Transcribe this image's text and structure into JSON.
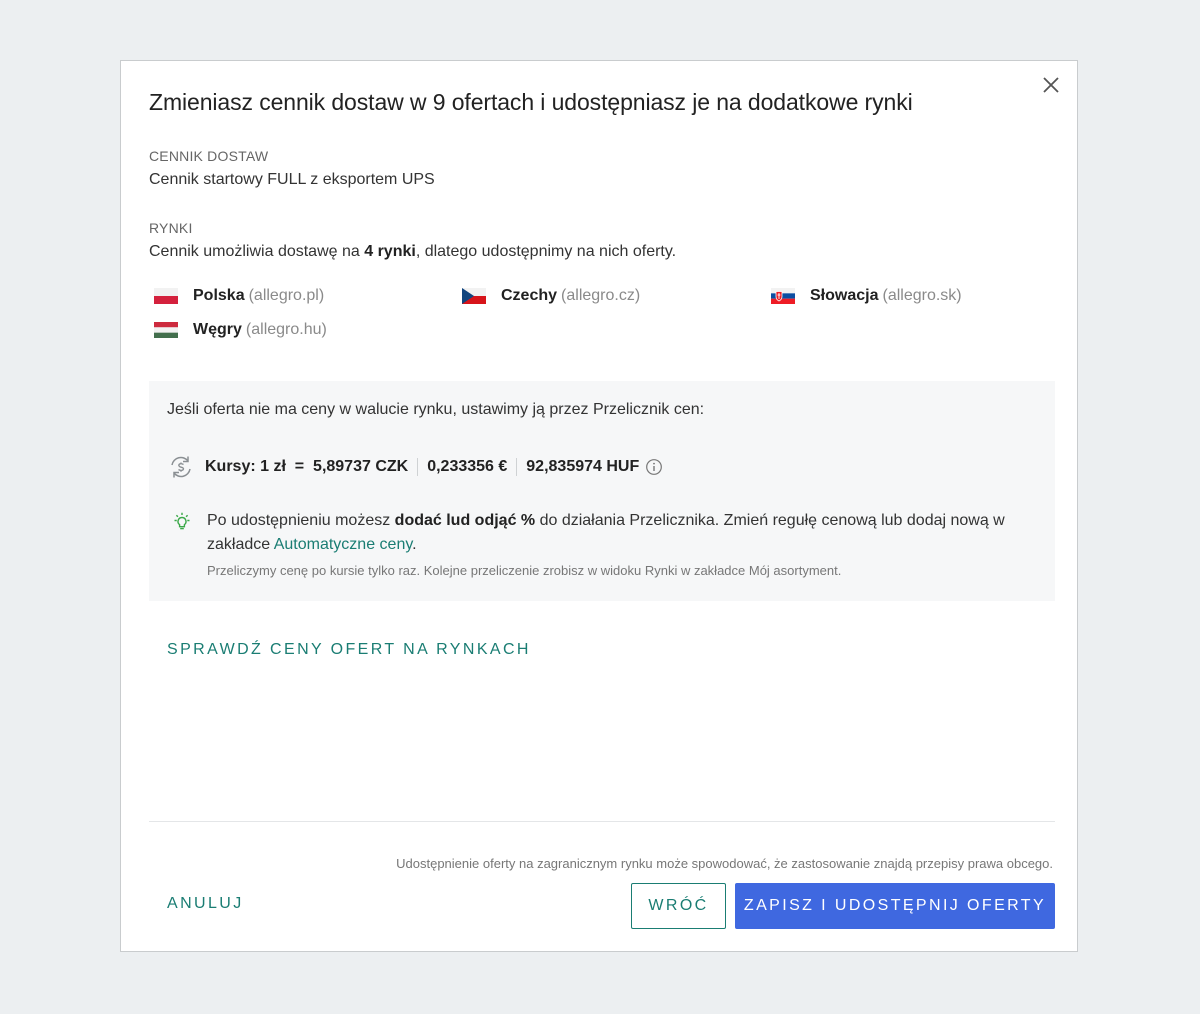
{
  "modal": {
    "title": "Zmieniasz cennik dostaw w 9 ofertach i udostępniasz je na dodatkowe rynki",
    "close_icon": "close-icon"
  },
  "shipping_price_list": {
    "label": "CENNIK DOSTAW",
    "value": "Cennik startowy FULL z eksportem UPS"
  },
  "markets": {
    "label": "RYNKI",
    "description_prefix": "Cennik umożliwia dostawę na ",
    "description_bold": "4 rynki",
    "description_suffix": ", dlatego udostępnimy na nich oferty.",
    "items": [
      {
        "name": "Polska",
        "domain": "(allegro.pl)",
        "flag": "poland-flag-icon"
      },
      {
        "name": "Czechy",
        "domain": "(allegro.cz)",
        "flag": "czech-flag-icon"
      },
      {
        "name": "Słowacja",
        "domain": "(allegro.sk)",
        "flag": "slovakia-flag-icon"
      },
      {
        "name": "Węgry",
        "domain": "(allegro.hu)",
        "flag": "hungary-flag-icon"
      }
    ]
  },
  "converter": {
    "lead": "Jeśli oferta nie ma ceny w walucie rynku, ustawimy ją przez Przelicznik cen:",
    "rates_prefix": "Kursy: 1 zł  =  5,89737 CZK",
    "rate_eur": "0,233356 €",
    "rate_huf": "92,835974 HUF",
    "tip_part1": "Po udostępnieniu możesz ",
    "tip_bold": "dodać lud odjąć %",
    "tip_part2": " do działania Przelicznika. Zmień regułę cenową lub dodaj nową w zakładce ",
    "tip_link": "Automatyczne ceny",
    "tip_end": ".",
    "note": "Przeliczymy cenę po kursie tylko raz. Kolejne przeliczenie zrobisz w widoku Rynki w zakładce Mój asortyment."
  },
  "check_prices_link": "SPRAWDŹ CENY OFERT NA RYNKACH",
  "footer": {
    "legal": "Udostępnienie oferty na zagranicznym rynku może spowodować, że zastosowanie znajdą przepisy prawa obcego.",
    "cancel_label": "ANULUJ",
    "back_label": "WRÓĆ",
    "save_label": "ZAPISZ I UDOSTĘPNIJ OFERTY"
  },
  "colors": {
    "accent_teal": "#1a7d73",
    "primary_blue": "#3f68e0",
    "tip_green": "#3aa848"
  }
}
